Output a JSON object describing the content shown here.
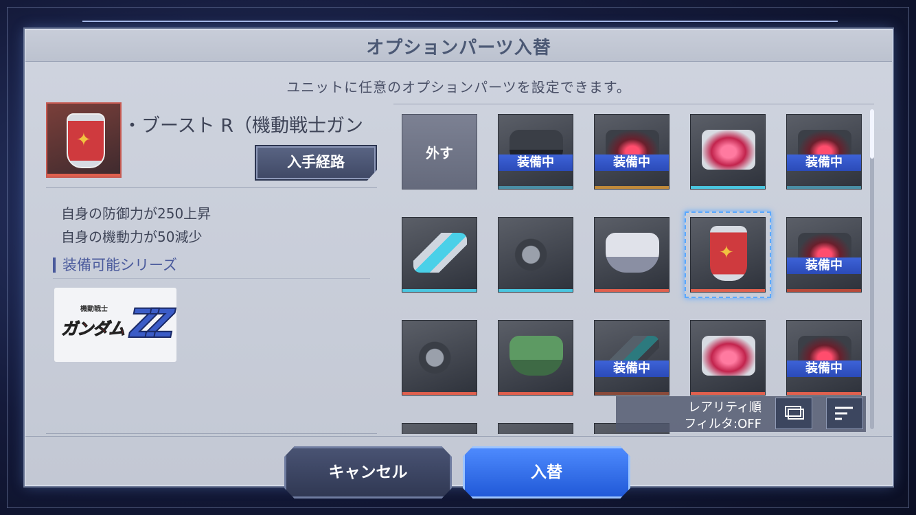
{
  "dialog": {
    "title": "オプションパーツ入替",
    "subtitle": "ユニットに任意のオプションパーツを設定できます。"
  },
  "selected_part": {
    "name": "・ブースト R（機動戦士ガン",
    "route_button": "入手経路",
    "effects": [
      "自身の防御力が250上昇",
      "自身の機動力が50減少"
    ],
    "series_heading": "装備可能シリーズ",
    "series_logo": {
      "small": "機動戦士",
      "main": "ガンダム",
      "mark": "ZZ"
    }
  },
  "grid": {
    "remove_label": "外す",
    "equipped_label": "装備中",
    "slots": [
      {
        "type": "remove"
      },
      {
        "art": "armor-b",
        "rarity_color": "#4a8fa6",
        "equipped": true
      },
      {
        "art": "mask",
        "rarity_color": "#c08a3a",
        "equipped": true
      },
      {
        "art": "mask-bright",
        "rarity_color": "#4ac6e0",
        "equipped": false
      },
      {
        "art": "mask",
        "rarity_color": "#4a8fa6",
        "equipped": true
      },
      {
        "art": "cyl",
        "rarity_color": "#4ac6e0",
        "equipped": false
      },
      {
        "art": "thruster",
        "rarity_color": "#4ac6e0",
        "equipped": false
      },
      {
        "art": "armor-w",
        "rarity_color": "#e0604e",
        "equipped": false
      },
      {
        "art": "shield-s",
        "rarity_color": "#e0604e",
        "equipped": false,
        "selected": true
      },
      {
        "art": "mask",
        "rarity_color": "#b84a3a",
        "equipped": true
      },
      {
        "art": "thruster",
        "rarity_color": "#e0604e",
        "equipped": false
      },
      {
        "art": "armor-g",
        "rarity_color": "#e0604e",
        "equipped": false
      },
      {
        "art": "cyl-dark",
        "rarity_color": "#8a4a3a",
        "equipped": true
      },
      {
        "art": "mask-bright",
        "rarity_color": "#e0604e",
        "equipped": false
      },
      {
        "art": "mask",
        "rarity_color": "#e0604e",
        "equipped": true
      }
    ]
  },
  "sort": {
    "order_label": "レアリティ順",
    "filter_label": "フィルタ:OFF",
    "view_icon": "card-view-icon",
    "sort_icon": "sort-lines-icon"
  },
  "buttons": {
    "cancel": "キャンセル",
    "confirm": "入替"
  },
  "colors": {
    "accent_blue": "#2b4bb8",
    "panel": "#c8cdd9",
    "confirm": "#2f6ae8"
  }
}
